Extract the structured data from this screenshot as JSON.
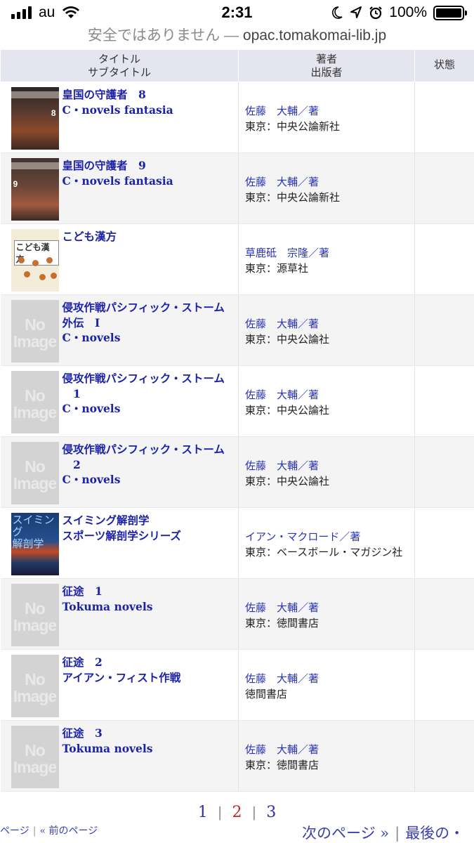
{
  "status_bar": {
    "carrier": "au",
    "time": "2:31",
    "battery": "100%",
    "icons": [
      "signal-icon",
      "wifi-icon",
      "moon-icon",
      "location-icon",
      "alarm-icon",
      "battery-icon"
    ]
  },
  "url_bar": {
    "insecure_label": "安全ではありません —",
    "host": "opac.tomakomai-lib.jp"
  },
  "table": {
    "headers": {
      "title_line1": "タイトル",
      "title_line2": "サブタイトル",
      "author_line1": "著者",
      "author_line2": "出版者",
      "status": "状態"
    },
    "rows": [
      {
        "title": "皇国の守護者　8",
        "subtitle": "C・novels fantasia",
        "author": "佐藤　大輔／著",
        "publisher": "東京：中央公論新社",
        "cover": "cover-image"
      },
      {
        "title": "皇国の守護者　9",
        "subtitle": "C・novels fantasia",
        "author": "佐藤　大輔／著",
        "publisher": "東京：中央公論新社",
        "cover": "cover-image"
      },
      {
        "title": "こども漢方",
        "subtitle": "",
        "author": "草鹿砥　宗隆／著",
        "publisher": "東京：源草社",
        "cover": "cover-image"
      },
      {
        "title": "侵攻作戦パシフィック・ストーム",
        "title_line2": "外伝　I",
        "subtitle": "C・novels",
        "author": "佐藤　大輔／著",
        "publisher": "東京：中央公論社",
        "cover": "no-image"
      },
      {
        "title": "侵攻作戦パシフィック・ストーム",
        "title_line2": "　1",
        "subtitle": "C・novels",
        "author": "佐藤　大輔／著",
        "publisher": "東京：中央公論社",
        "cover": "no-image"
      },
      {
        "title": "侵攻作戦パシフィック・ストーム",
        "title_line2": "　2",
        "subtitle": "C・novels",
        "author": "佐藤　大輔／著",
        "publisher": "東京：中央公論社",
        "cover": "no-image"
      },
      {
        "title": "スイミング解剖学",
        "subtitle": "スポーツ解剖学シリーズ",
        "author": "イアン・マクロード／著",
        "publisher": "東京：ベースボール・マガジン社",
        "cover": "cover-image"
      },
      {
        "title": "征途　1",
        "subtitle": "Tokuma novels",
        "author": "佐藤　大輔／著",
        "publisher": "東京：徳間書店",
        "cover": "no-image"
      },
      {
        "title": "征途　2",
        "subtitle": "アイアン・フィスト作戦",
        "author": "佐藤　大輔／著",
        "publisher": "徳間書店",
        "cover": "no-image"
      },
      {
        "title": "征途　3",
        "subtitle": "Tokuma novels",
        "author": "佐藤　大輔／著",
        "publisher": "東京：徳間書店",
        "cover": "no-image"
      }
    ],
    "no_image_text": {
      "line1": "No",
      "line2": "Image"
    },
    "cover_texts": {
      "vol8": "8",
      "vol9": "9",
      "kanpo": "こども漢方",
      "swim_line1": "スイミング",
      "swim_line2": "解剖学"
    }
  },
  "pagination": {
    "pages": [
      "1",
      "2",
      "3"
    ],
    "current": "2",
    "separator": "|",
    "first_page_partial": "ページ",
    "prev_page": "« 前のページ",
    "next_page": "次のページ »",
    "last_page_partial": "最後の・"
  },
  "colors": {
    "link": "#1c22a7",
    "current_page": "#c4262a",
    "header_bg": "#e4e5ee"
  }
}
